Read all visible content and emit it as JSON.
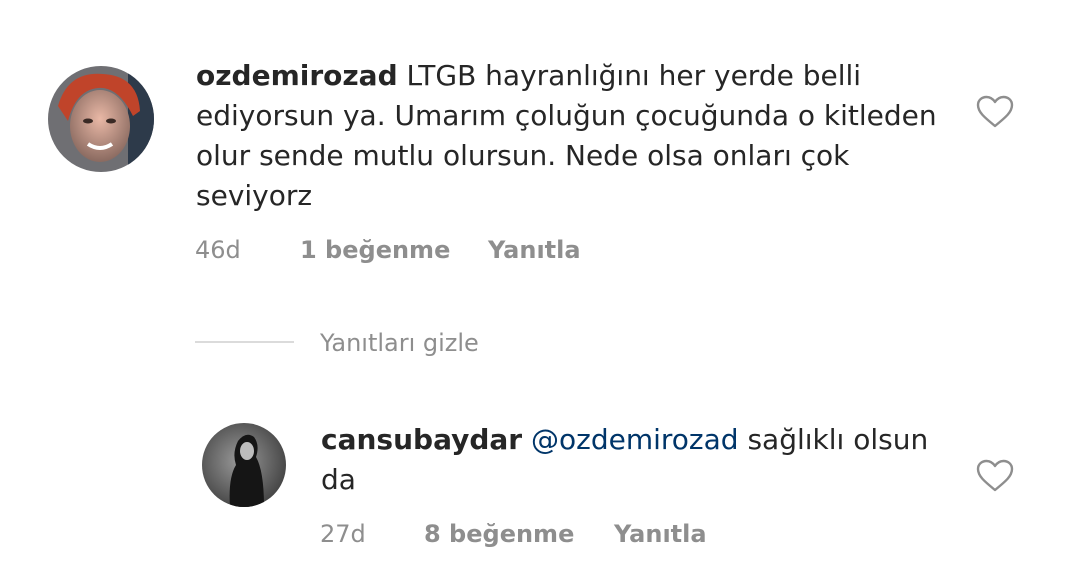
{
  "comments": [
    {
      "username": "ozdemirozad",
      "text": "LTGB hayranlığını her yerde belli ediyorsun ya. Umarım çoluğun çocuğunda o kitleden olur sende mutlu olursun. Nede olsa onları çok seviyorz",
      "time": "46d",
      "likes": "1 beğenme",
      "reply_label": "Yanıtla",
      "like_icon": "heart-outline-icon"
    },
    {
      "username": "cansubaydar",
      "mention": "@ozdemirozad",
      "text": "sağlıklı olsun da",
      "time": "27d",
      "likes": "8 beğenme",
      "reply_label": "Yanıtla",
      "like_icon": "heart-outline-icon"
    }
  ],
  "replies_toggle": {
    "label": "Yanıtları gizle"
  },
  "colors": {
    "text": "#262626",
    "secondary": "#8e8e8e",
    "mention": "#003569",
    "divider": "#dbdbdb"
  }
}
